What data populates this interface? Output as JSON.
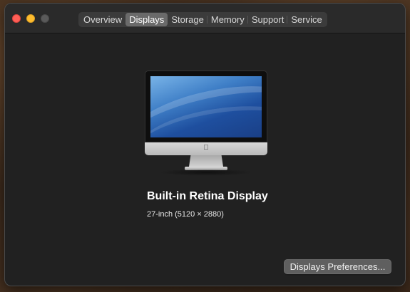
{
  "window": {
    "tabs": [
      {
        "label": "Overview",
        "active": false
      },
      {
        "label": "Displays",
        "active": true
      },
      {
        "label": "Storage",
        "active": false
      },
      {
        "label": "Memory",
        "active": false
      },
      {
        "label": "Support",
        "active": false
      },
      {
        "label": "Service",
        "active": false
      }
    ]
  },
  "display": {
    "icon": "imac-icon",
    "name": "Built-in Retina Display",
    "spec": "27-inch (5120 × 2880)"
  },
  "actions": {
    "preferences_label": "Displays Preferences..."
  },
  "colors": {
    "window_bg": "#212121",
    "close": "#fe5f57",
    "minimize": "#febc2e",
    "zoom_disabled": "#5a5a5a",
    "active_tab": "#6a6a6a"
  }
}
